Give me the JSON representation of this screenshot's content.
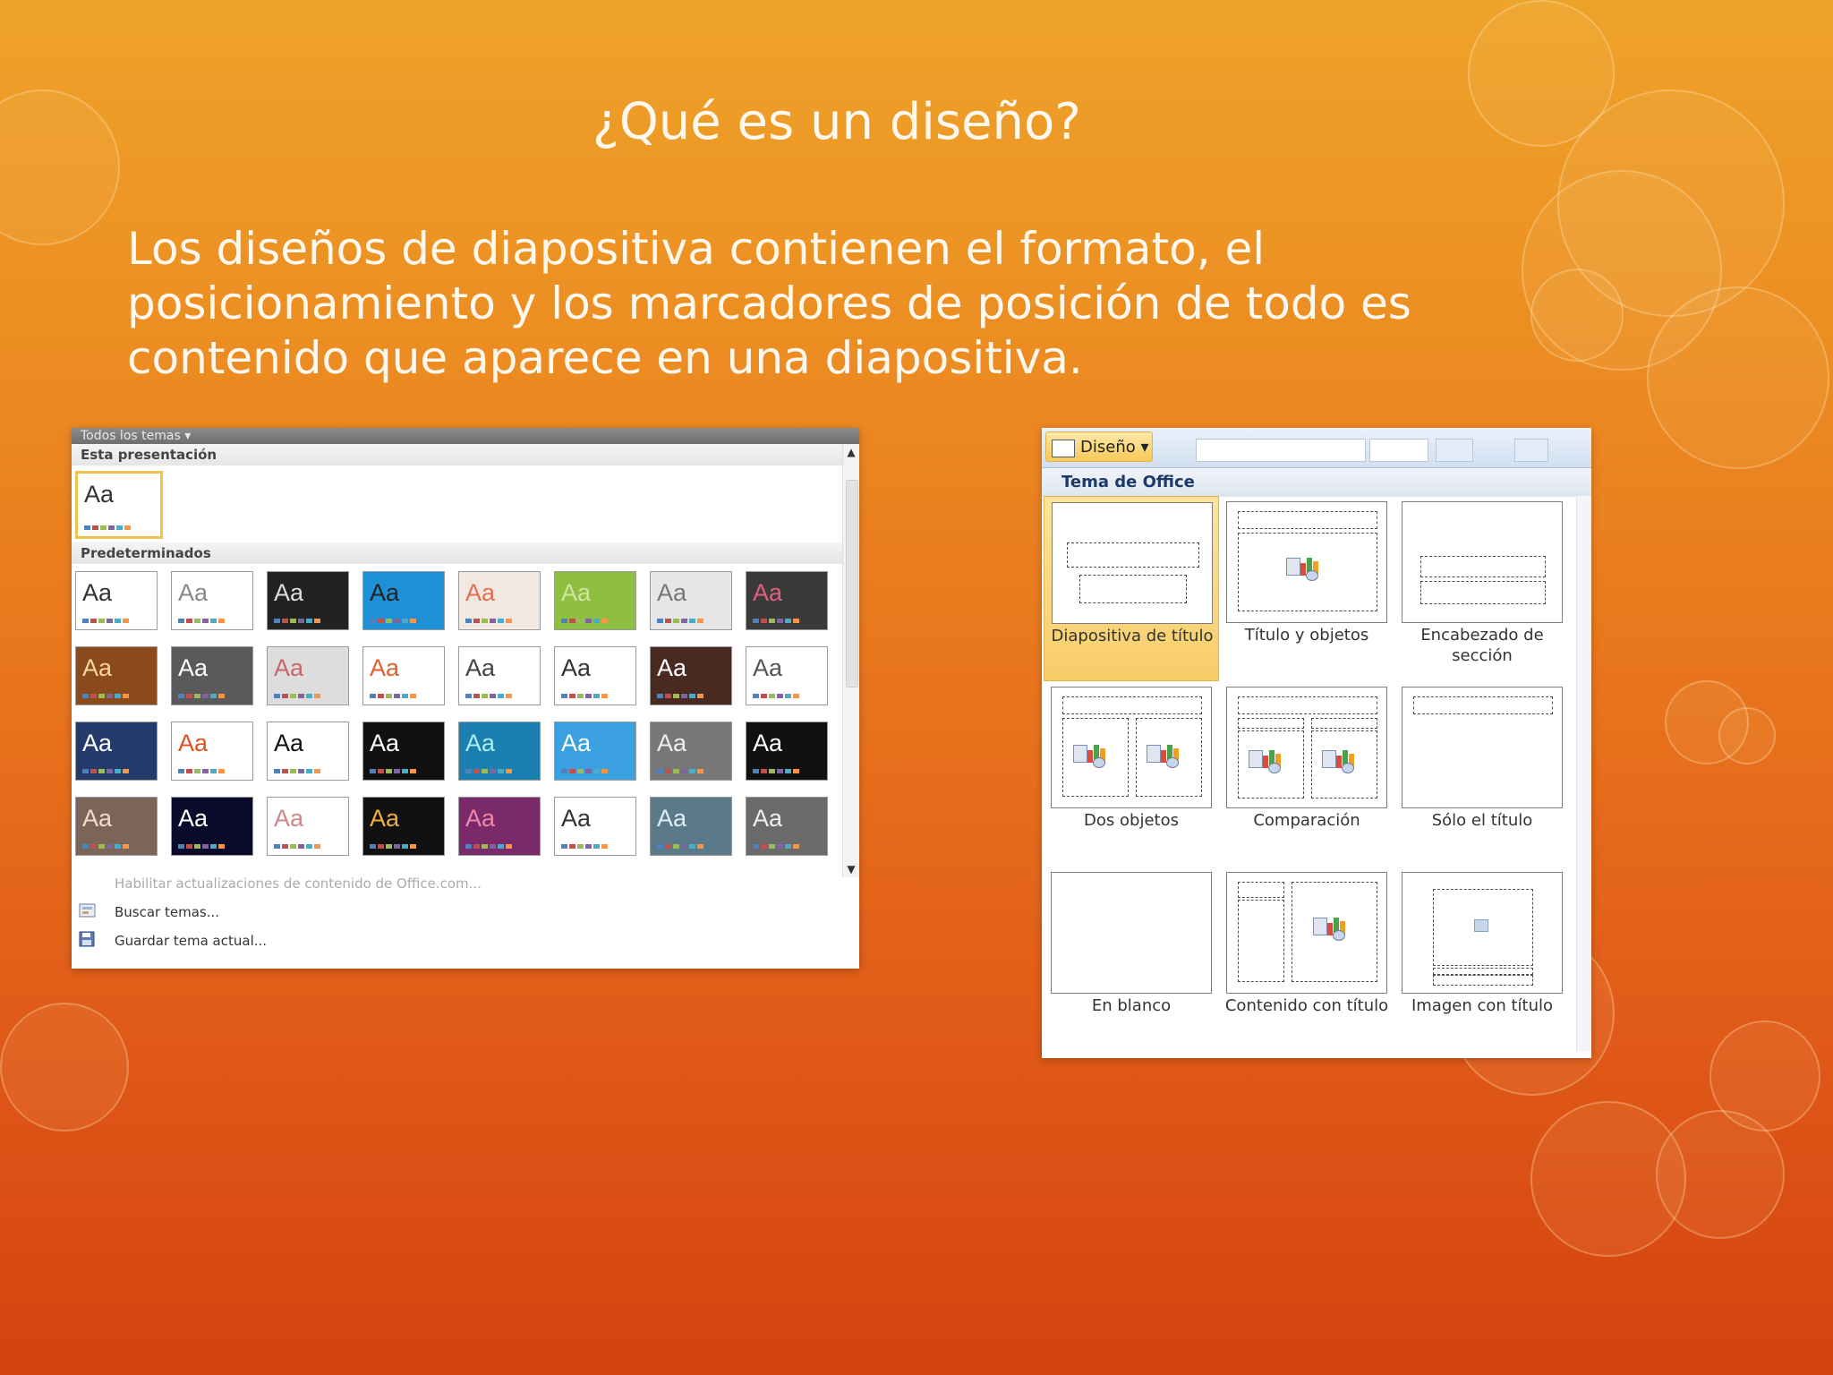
{
  "slide": {
    "title": "¿Qué es un diseño?",
    "body_lines": [
      "Los diseños de diapositiva contienen el formato, el",
      "posicionamiento y los marcadores de posición de todo es",
      "contenido que aparece en una diapositiva."
    ]
  },
  "colors": {
    "background_top": "#eea32a",
    "background_bottom": "#d4420f",
    "selection_gold": "#f8cd6a",
    "layout_header_text": "#1e3a6b"
  },
  "themes_gallery": {
    "header": "Todos los temas ▾",
    "section_current": "Esta presentación",
    "section_builtin": "Predeterminados",
    "aa_label": "Aa",
    "commands": [
      "Habilitar actualizaciones de contenido de Office.com...",
      "Buscar temas...",
      "Guardar tema actual..."
    ],
    "scroll_up": "▲",
    "scroll_down": "▼"
  },
  "layout_gallery": {
    "ribbon_button": "Diseño ▾",
    "section": "Tema de Office",
    "layouts": [
      {
        "label": "Diapositiva de título",
        "selected": true
      },
      {
        "label": "Título y objetos",
        "selected": false
      },
      {
        "label": "Encabezado de sección",
        "selected": false
      },
      {
        "label": "Dos objetos",
        "selected": false
      },
      {
        "label": "Comparación",
        "selected": false
      },
      {
        "label": "Sólo el título",
        "selected": false
      },
      {
        "label": "En blanco",
        "selected": false
      },
      {
        "label": "Contenido con título",
        "selected": false
      },
      {
        "label": "Imagen con título",
        "selected": false
      }
    ]
  }
}
